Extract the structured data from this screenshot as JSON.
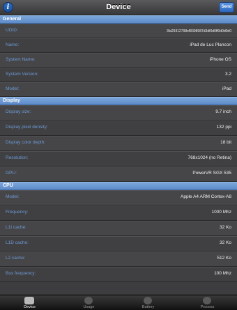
{
  "navbar": {
    "title": "Device",
    "send_label": "Send",
    "info_icon": "info-icon"
  },
  "sections": {
    "general": {
      "title": "General",
      "rows": [
        {
          "label": "UDID:",
          "value": "3fa29312798ef8398987d3df0d0ff0d0d0d0"
        },
        {
          "label": "Name:",
          "value": "iPad de Luc Plancon"
        },
        {
          "label": "System Name:",
          "value": "iPhone OS"
        },
        {
          "label": "System Version:",
          "value": "3.2"
        },
        {
          "label": "Model:",
          "value": "iPad"
        }
      ]
    },
    "display": {
      "title": "Display",
      "rows": [
        {
          "label": "Display size:",
          "value": "9.7 inch"
        },
        {
          "label": "Display pixel density:",
          "value": "132 ppi"
        },
        {
          "label": "Display color depth:",
          "value": "18 bit"
        },
        {
          "label": "Resolution:",
          "value": "768x1024 (no Retina)"
        },
        {
          "label": "GPU:",
          "value": "PowerVR SGX 535"
        }
      ]
    },
    "cpu": {
      "title": "CPU",
      "rows": [
        {
          "label": "Model:",
          "value": "Apple A4 ARM Cortex-A8"
        },
        {
          "label": "Frequency:",
          "value": "1000 Mhz"
        },
        {
          "label": "L1I cache:",
          "value": "32 Ko"
        },
        {
          "label": "L1D cache:",
          "value": "32 Ko"
        },
        {
          "label": "L2 cache:",
          "value": "512 Ko"
        },
        {
          "label": "Bus frequency:",
          "value": "100 Mhz"
        }
      ]
    }
  },
  "tabbar": {
    "tabs": [
      {
        "label": "Device",
        "icon": "device-icon",
        "active": true
      },
      {
        "label": "Usage",
        "icon": "usage-icon",
        "active": false
      },
      {
        "label": "Battery",
        "icon": "battery-icon",
        "active": false
      },
      {
        "label": "Process",
        "icon": "process-icon",
        "active": false
      }
    ]
  }
}
